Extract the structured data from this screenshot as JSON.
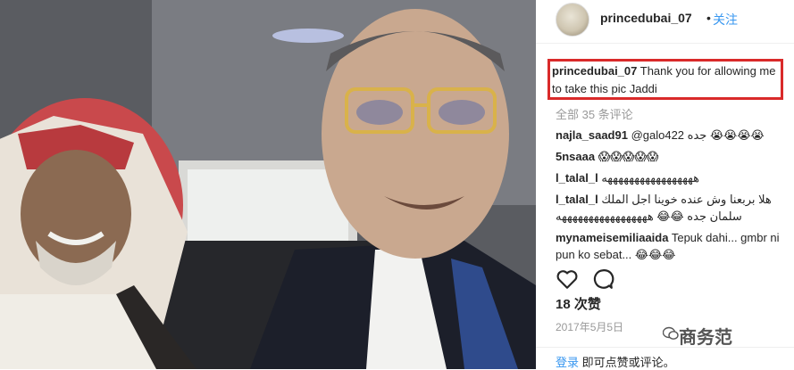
{
  "post": {
    "username": "princedubai_07",
    "follow_separator": "•",
    "follow_label": "关注",
    "caption_user": "princedubai_07",
    "caption_text": " Thank you for allowing me to take this pic Jaddi",
    "all_comments": "全部 35 条评论",
    "comments": [
      {
        "user": "najla_saad91",
        "text": " @galo422 جده 😭😭😭😭"
      },
      {
        "user": "5nsaaa",
        "text": " 😱😱😱😱😱"
      },
      {
        "user": "l_talal_l",
        "text": " هههههههههههههههههه"
      },
      {
        "user": "l_talal_l",
        "text": " هلا بربعنا وش عنده خوينا اجل الملك سلمان جده 😂😂 هههههههههههههههههه"
      },
      {
        "user": "mynameisemiliaaida",
        "text": " Tepuk dahi... gmbr ni pun ko sebat... 😂😂😂"
      }
    ],
    "likes": "18 次赞",
    "date": "2017年5月5日",
    "footer_link": "登录",
    "footer_text": " 即可点赞或评论。"
  },
  "watermark": "商务范",
  "colors": {
    "accent": "#3897f0",
    "highlight": "#d92a2a",
    "muted": "#999999"
  },
  "icons": [
    "heart-icon",
    "comment-icon",
    "wechat-icon"
  ]
}
